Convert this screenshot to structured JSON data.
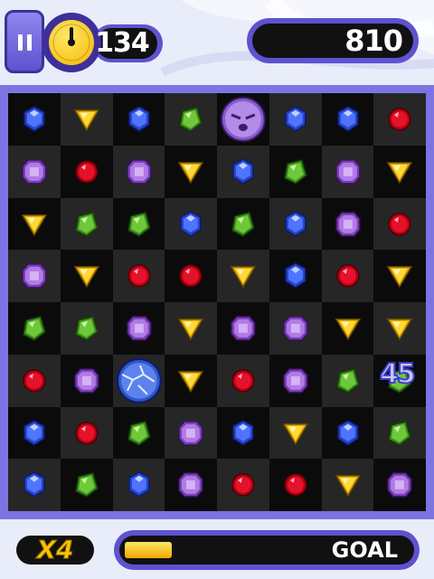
{
  "hud": {
    "timer": "134",
    "score": "810",
    "pause_icon": "pause-icon",
    "clock_icon": "stopwatch-icon"
  },
  "board": {
    "rows": 8,
    "cols": 8,
    "grid": [
      [
        "blue",
        "yellow",
        "blue",
        "green",
        "purple-face",
        "blue",
        "blue",
        "red"
      ],
      [
        "purple",
        "red",
        "purple",
        "yellow",
        "blue",
        "green",
        "purple",
        "yellow"
      ],
      [
        "yellow",
        "green",
        "green",
        "blue",
        "green",
        "blue",
        "purple",
        "red"
      ],
      [
        "purple",
        "yellow",
        "red",
        "red",
        "yellow",
        "blue",
        "red",
        "yellow"
      ],
      [
        "green",
        "green",
        "purple",
        "yellow",
        "purple",
        "purple",
        "yellow",
        "yellow"
      ],
      [
        "red",
        "purple",
        "blue-cracked",
        "yellow",
        "red",
        "purple",
        "green",
        "green"
      ],
      [
        "blue",
        "red",
        "green",
        "purple",
        "blue",
        "yellow",
        "blue",
        "green"
      ],
      [
        "blue",
        "green",
        "blue",
        "purple",
        "red",
        "red",
        "yellow",
        "purple"
      ]
    ],
    "combo_popup": "45"
  },
  "bottom": {
    "multiplier": "X4",
    "goal_label": "GOAL",
    "goal_progress": 0.22
  },
  "colors": {
    "frame": "#7d73e3",
    "hud_purple": "#5f52cf",
    "gold": "#f6c400"
  }
}
